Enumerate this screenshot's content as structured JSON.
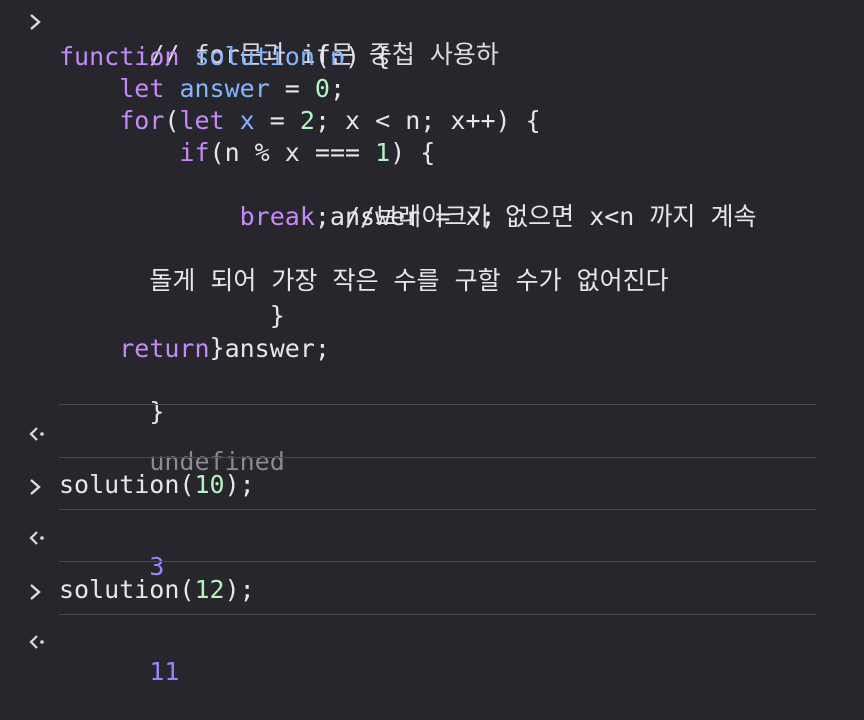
{
  "entries": [
    {
      "type": "input",
      "lines": [
        "// for문과 if문 중첩 사용하",
        "function solution(n) {",
        "    let answer = 0;",
        "    for(let x = 2; x < n; x++) {",
        "        if(n % x === 1) {",
        "            answer = x;",
        "            break; //브레이크가 없으면 x<n 까지 계속",
        "돌게 되어 가장 작은 수를 구할 수가 없어진다",
        "        }",
        "    }",
        "    return answer;",
        "}"
      ]
    },
    {
      "type": "output",
      "value": "undefined"
    },
    {
      "type": "input",
      "value": "solution(10);"
    },
    {
      "type": "output",
      "value": "3"
    },
    {
      "type": "input",
      "value": "solution(12);"
    },
    {
      "type": "output",
      "value": "11"
    }
  ],
  "code": {
    "l1_comment": "// for문과 if문 중첩 사용하",
    "l2_kw": "function",
    "l2_sp": " ",
    "l2_fn": "solution",
    "l2_p1": "(",
    "l2_param": "n",
    "l2_rest": ") {",
    "l3_indent": "    ",
    "l3_kw": "let",
    "l3_sp": " ",
    "l3_var": "answer",
    "l3_eq": " = ",
    "l3_num": "0",
    "l3_end": ";",
    "l4_indent": "    ",
    "l4_kw": "for",
    "l4_p": "(",
    "l4_kw2": "let",
    "l4_sp": " ",
    "l4_var": "x",
    "l4_eq": " = ",
    "l4_num": "2",
    "l4_rest": "; x < n; x++) {",
    "l5_indent": "        ",
    "l5_kw": "if",
    "l5_a": "(n % x === ",
    "l5_num": "1",
    "l5_b": ") {",
    "l6_text": "            answer = x;",
    "l7_indent": "            ",
    "l7_kw": "break",
    "l7_rest": "; //브레이크가 없으면 x<n 까지 계속",
    "l8_text": "돌게 되어 가장 작은 수를 구할 수가 없어진다",
    "l9_text": "        }",
    "l10_text": "    }",
    "l11_indent": "    ",
    "l11_kw": "return",
    "l11_rest": " answer;",
    "l12_text": "}"
  },
  "outputs": {
    "o1": "undefined",
    "o2": "3",
    "o3": "11"
  },
  "inputs": {
    "i2_fn": "solution(",
    "i2_num": "10",
    "i2_end": ");",
    "i3_fn": "solution(",
    "i3_num": "12",
    "i3_end": ");"
  },
  "icons": {
    "input_prompt": "chevron-right-icon",
    "output_prompt": "return-arrow-icon"
  },
  "colors": {
    "background": "#27262c",
    "keyword": "#c589f8",
    "function": "#85b4ff",
    "number": "#b6f2bf",
    "result_number": "#9d82ff",
    "undefined": "#8c8b92",
    "separator": "#4b4a51"
  }
}
